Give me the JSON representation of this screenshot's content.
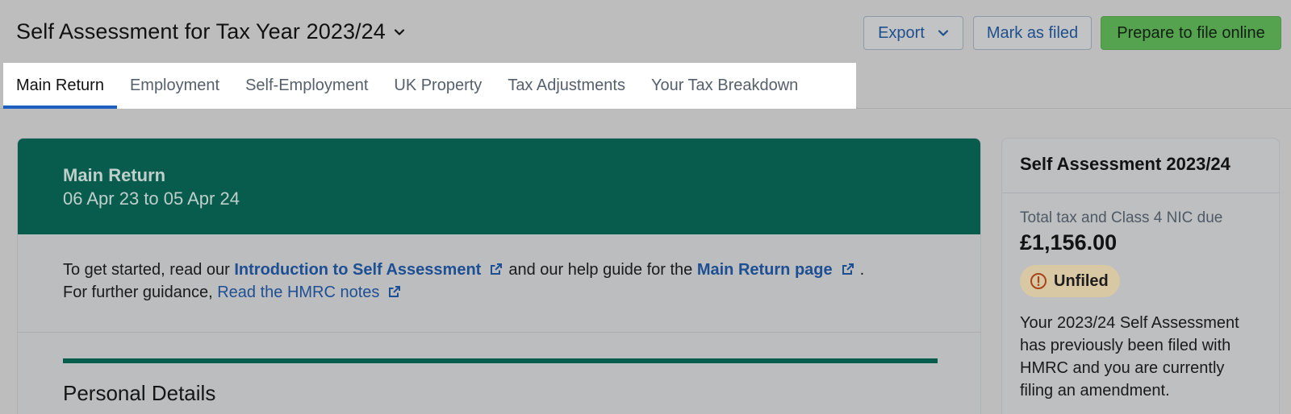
{
  "header": {
    "title": "Self Assessment for Tax Year 2023/24",
    "export_label": "Export",
    "mark_filed_label": "Mark as filed",
    "prepare_label": "Prepare to file online"
  },
  "tabs": [
    {
      "label": "Main Return",
      "active": true
    },
    {
      "label": "Employment",
      "active": false
    },
    {
      "label": "Self-Employment",
      "active": false
    },
    {
      "label": "UK Property",
      "active": false
    },
    {
      "label": "Tax Adjustments",
      "active": false
    },
    {
      "label": "Your Tax Breakdown",
      "active": false
    }
  ],
  "main": {
    "banner_title": "Main Return",
    "banner_period": "06 Apr 23 to 05 Apr 24",
    "intro_prefix": "To get started, read our",
    "intro_link1": "Introduction to Self Assessment",
    "intro_mid": "and our help guide for the",
    "intro_link2": "Main Return page",
    "intro_suffix": ".",
    "guidance_prefix": "For further guidance,",
    "guidance_link": "Read the HMRC notes",
    "section_title": "Personal Details"
  },
  "side": {
    "title": "Self Assessment 2023/24",
    "total_label": "Total tax and Class 4 NIC due",
    "total_amount": "£1,156.00",
    "status": "Unfiled",
    "note": "Your 2023/24 Self Assessment has previously been filed with HMRC and you are currently filing an amendment."
  },
  "colors": {
    "brand_green": "#075c4e",
    "primary_button": "#56a34f",
    "link": "#1e4f93",
    "tab_active_underline": "#1d5fc0",
    "status_badge": "#d8c9a4"
  },
  "icons": {
    "title_dropdown": "chevron-down-icon",
    "export_dropdown": "chevron-down-icon",
    "external_link": "external-link-icon",
    "status": "alert-circle-icon"
  }
}
